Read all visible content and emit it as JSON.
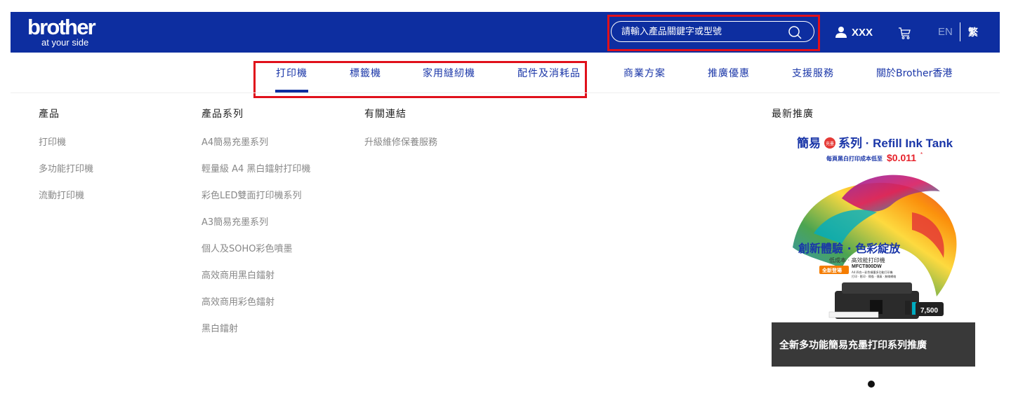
{
  "header": {
    "logo_word": "brother",
    "logo_tagline": "at your side",
    "search_placeholder": "請輸入產品關鍵字或型號",
    "user_name": "XXX",
    "lang_en": "EN",
    "lang_zh": "繁"
  },
  "nav": {
    "items": [
      "打印機",
      "標籤機",
      "家用縫紉機",
      "配件及消耗品",
      "商業方案",
      "推廣優惠",
      "支援服務",
      "關於Brother香港"
    ],
    "active_index": 0
  },
  "menu": {
    "col1": {
      "title": "產品",
      "links": [
        "打印機",
        "多功能打印機",
        "流動打印機"
      ]
    },
    "col2": {
      "title": "產品系列",
      "links": [
        "A4簡易充墨系列",
        "輕量級 A4 黑白鐳射打印機",
        "彩色LED雙面打印機系列",
        "A3簡易充墨系列",
        "個人及SOHO彩色噴墨",
        "高效商用黑白鐳射",
        "高效商用彩色鐳射",
        "黑白鐳射"
      ]
    },
    "col3": {
      "title": "有關連結",
      "links": [
        "升級維修保養服務"
      ]
    },
    "col4": {
      "title": "最新推廣"
    }
  },
  "promo": {
    "headline_a": "簡易",
    "headline_badge": "充墨",
    "headline_b": "系列 · Refill Ink Tank",
    "sub": "每頁黑白打印成本低至",
    "price": "$0.011",
    "price_mark": "*",
    "tagline": "創新體驗 · 色彩綻放",
    "tagline_sub": "低成本 · 高效能打印機",
    "badge": "全新登場",
    "model": "MFCT800DW",
    "model_sub_1": "A4 四合一彩色噴墨多功能打印機",
    "model_sub_2": "打印 · 影印 · 掃描 · 傳真 · 無線網絡",
    "model_price": "7,500",
    "caption": "全新多功能簡易充墨打印系列推廣"
  },
  "colors": {
    "brand_blue": "#0d2ea0",
    "highlight_red": "#e0101b",
    "nav_text": "#1a36a8",
    "price_red": "#e6212a"
  }
}
